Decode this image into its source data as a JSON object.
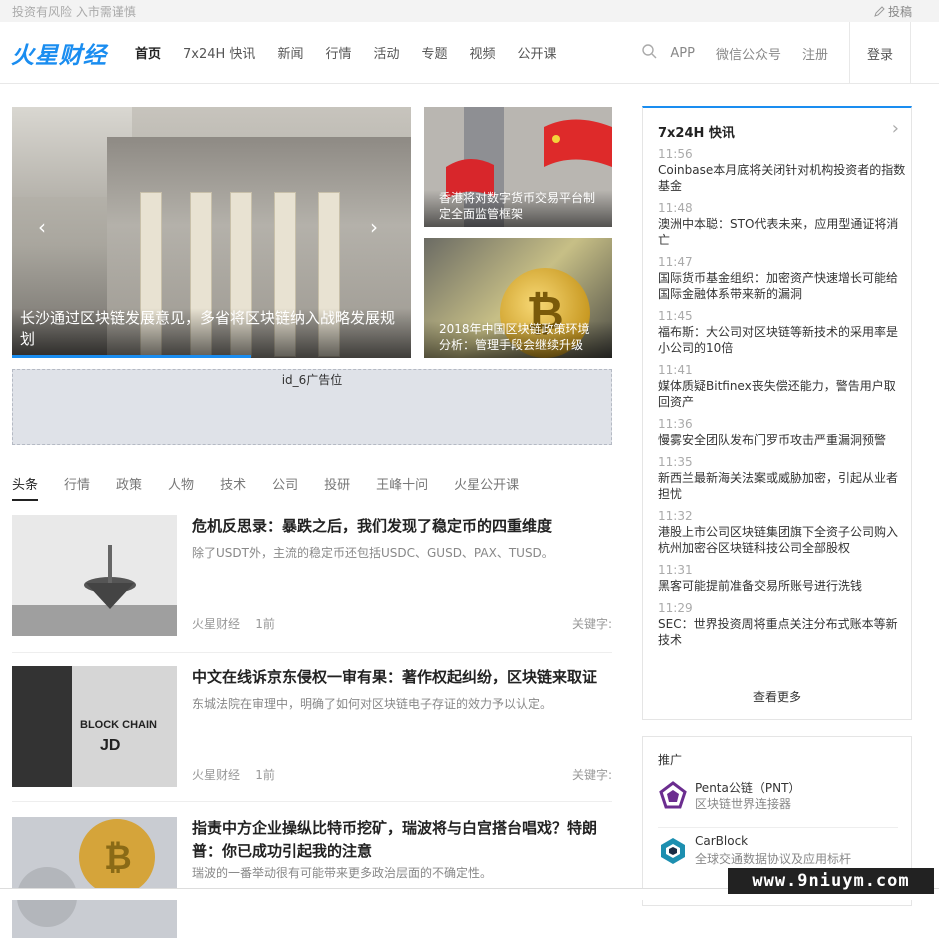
{
  "topbar": {
    "notice": "投资有风险 入市需谨慎",
    "contribute": "投稿"
  },
  "header": {
    "logo": "火星财经",
    "nav": [
      "首页",
      "7x24H 快讯",
      "新闻",
      "行情",
      "活动",
      "专题",
      "视频",
      "公开课"
    ],
    "right": {
      "app": "APP",
      "wechat": "微信公众号",
      "register": "注册",
      "login": "登录"
    }
  },
  "hero": {
    "caption": "长沙通过区块链发展意见，多省将区块链纳入战略发展规划",
    "progress": 0.6
  },
  "side_cards": [
    {
      "caption": "香港将对数字货币交易平台制定全面监管框架"
    },
    {
      "caption": "2018年中国区块链政策环境分析：管理手段会继续升级"
    }
  ],
  "ad": {
    "label": "id_6广告位"
  },
  "tabs": [
    "头条",
    "行情",
    "政策",
    "人物",
    "技术",
    "公司",
    "投研",
    "王峰十问",
    "火星公开课"
  ],
  "articles": [
    {
      "title": "危机反思录：暴跌之后，我们发现了稳定币的四重维度",
      "desc": "除了USDT外，主流的稳定币还包括USDC、GUSD、PAX、TUSD。",
      "source": "火星财经",
      "time": "1前",
      "keywords": "关键字:"
    },
    {
      "title": "中文在线诉京东侵权一审有果：著作权起纠纷，区块链来取证",
      "desc": "东城法院在审理中，明确了如何对区块链电子存证的效力予以认定。",
      "source": "火星财经",
      "time": "1前",
      "keywords": "关键字:"
    },
    {
      "title": "指责中方企业操纵比特币挖矿，瑞波将与白宫搭台唱戏？特朗普：你已成功引起我的注意",
      "desc": "瑞波的一番举动很有可能带来更多政治层面的不确定性。"
    }
  ],
  "flash": {
    "title": "7x24H 快讯",
    "items": [
      {
        "time": "11:56",
        "text": "Coinbase本月底将关闭针对机构投资者的指数基金"
      },
      {
        "time": "11:48",
        "text": "澳洲中本聪：STO代表未来，应用型通证将消亡"
      },
      {
        "time": "11:47",
        "text": "国际货币基金组织：加密资产快速增长可能给国际金融体系带来新的漏洞"
      },
      {
        "time": "11:45",
        "text": "福布斯：大公司对区块链等新技术的采用率是小公司的10倍"
      },
      {
        "time": "11:41",
        "text": "媒体质疑Bitfinex丧失偿还能力，警告用户取回资产"
      },
      {
        "time": "11:36",
        "text": "慢雾安全团队发布门罗币攻击严重漏洞预警"
      },
      {
        "time": "11:35",
        "text": "新西兰最新海关法案或威胁加密，引起从业者担忧"
      },
      {
        "time": "11:32",
        "text": "港股上市公司区块链集团旗下全资子公司购入杭州加密谷区块链科技公司全部股权"
      },
      {
        "time": "11:31",
        "text": "黑客可能提前准备交易所账号进行洗钱"
      },
      {
        "time": "11:29",
        "text": "SEC：世界投资周将重点关注分布式账本等新技术"
      }
    ],
    "more": "查看更多"
  },
  "promo": {
    "title": "推广",
    "items": [
      {
        "name": "Penta公链（PNT）",
        "sub": "区块链世界连接器"
      },
      {
        "name": "CarBlock",
        "sub": "全球交通数据协议及应用标杆"
      }
    ]
  },
  "watermark": "www.9niuym.com"
}
